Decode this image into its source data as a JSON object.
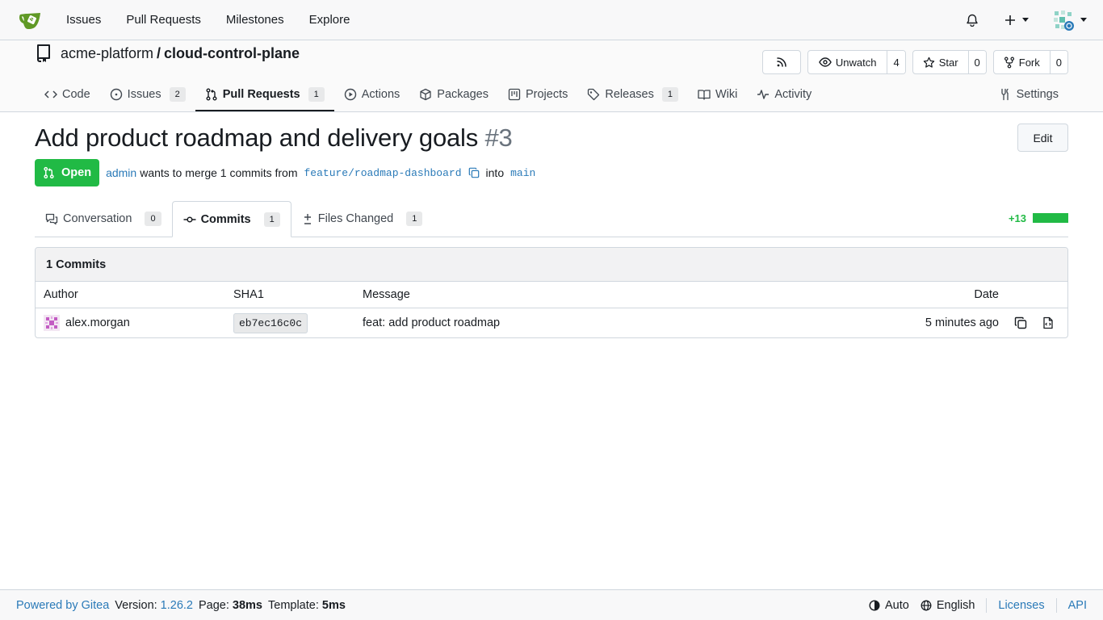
{
  "topnav": {
    "items": [
      "Issues",
      "Pull Requests",
      "Milestones",
      "Explore"
    ]
  },
  "repo": {
    "owner": "acme-platform",
    "separator": "/",
    "name": "cloud-control-plane",
    "watch_label": "Unwatch",
    "watch_count": "4",
    "star_label": "Star",
    "star_count": "0",
    "fork_label": "Fork",
    "fork_count": "0"
  },
  "repo_tabs": {
    "code": "Code",
    "issues": "Issues",
    "issues_count": "2",
    "pulls": "Pull Requests",
    "pulls_count": "1",
    "actions": "Actions",
    "packages": "Packages",
    "projects": "Projects",
    "releases": "Releases",
    "releases_count": "1",
    "wiki": "Wiki",
    "activity": "Activity",
    "settings": "Settings"
  },
  "pr": {
    "title": "Add product roadmap and delivery goals",
    "number": "#3",
    "edit_label": "Edit",
    "state": "Open",
    "author": "admin",
    "merge_text": "wants to merge 1 commits from",
    "head_branch": "feature/roadmap-dashboard",
    "into_text": "into",
    "base_branch": "main"
  },
  "pr_tabs": {
    "conversation": "Conversation",
    "conversation_count": "0",
    "commits": "Commits",
    "commits_count": "1",
    "files": "Files Changed",
    "files_count": "1",
    "additions": "+13"
  },
  "commits": {
    "heading": "1 Commits",
    "columns": {
      "author": "Author",
      "sha": "SHA1",
      "message": "Message",
      "date": "Date"
    },
    "rows": [
      {
        "author": "alex.morgan",
        "sha": "eb7ec16c0c",
        "message": "feat: add product roadmap",
        "date": "5 minutes ago"
      }
    ]
  },
  "footer": {
    "powered": "Powered by Gitea",
    "version_label": "Version:",
    "version": "1.26.2",
    "page_label": "Page:",
    "page_time": "38ms",
    "template_label": "Template:",
    "template_time": "5ms",
    "theme": "Auto",
    "language": "English",
    "licenses": "Licenses",
    "api": "API"
  },
  "colors": {
    "accent_green": "#21ba45",
    "link_blue": "#2a7ab8",
    "border": "#d0d7de"
  }
}
